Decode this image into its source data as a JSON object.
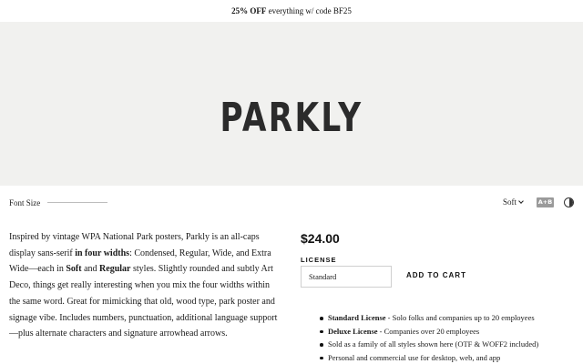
{
  "promo": {
    "bold": "25% OFF",
    "text": " everything w/ code BF25"
  },
  "hero": {
    "title": "PARKLY"
  },
  "controls": {
    "font_size_label": "Font Size",
    "style_value": "Soft",
    "ab_toggle": "A+B"
  },
  "description": {
    "t1": "Inspired by vintage WPA National Park posters, Parkly is an all-caps display sans-serif ",
    "b1": "in four widths",
    "t2": ": Condensed, Regular, Wide, and Extra Wide—each in ",
    "b2": "Soft",
    "t3": " and ",
    "b3": "Regular",
    "t4": " styles. Slightly rounded and subtly Art Deco, things get really interesting when you mix the four widths within the same word. Great for mimicking that old, wood type, park poster and signage vibe. Includes numbers, punctuation, additional language support—plus alternate characters and signature arrowhead arrows."
  },
  "purchase": {
    "price": "$24.00",
    "license_label": "LICENSE",
    "license_value": "Standard",
    "add_to_cart": "ADD TO CART"
  },
  "features": [
    {
      "bold": "Standard License",
      "text": " - Solo folks and companies up to 20 employees"
    },
    {
      "bold": "Deluxe License",
      "text": " - Companies over 20 employees"
    },
    {
      "bold": "",
      "text": "Sold as a family of all styles shown here (OTF & WOFF2 included)"
    },
    {
      "bold": "",
      "text": "Personal and commercial use for desktop, web, and app"
    }
  ]
}
